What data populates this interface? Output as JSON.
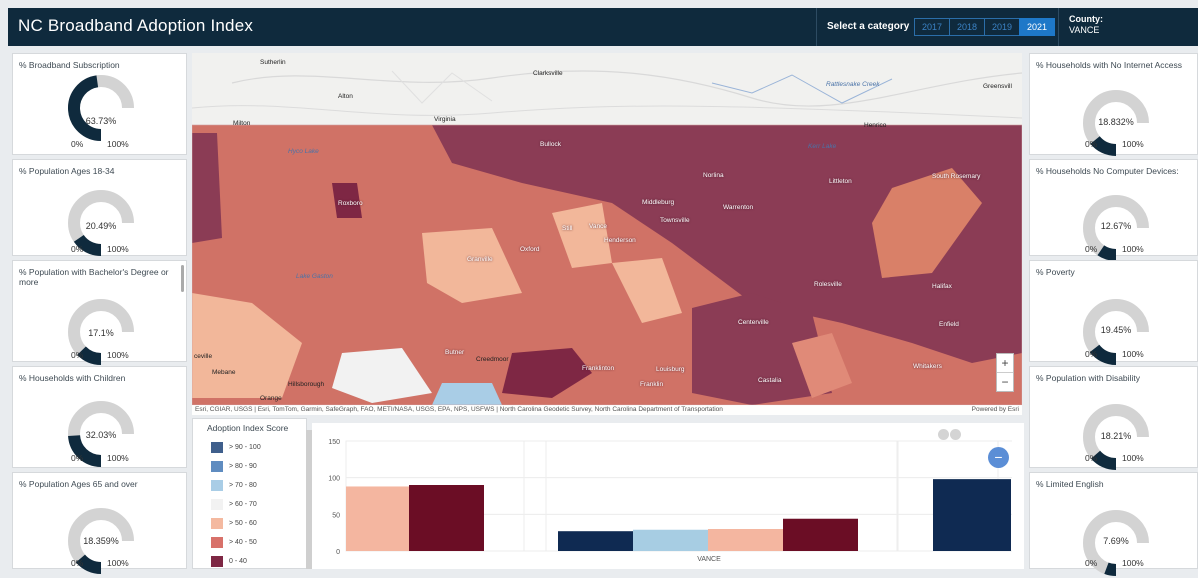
{
  "header": {
    "title": "NC Broadband Adoption Index",
    "category_label": "Select a category",
    "years": [
      "2017",
      "2018",
      "2019",
      "2021"
    ],
    "selected_year": "2021",
    "county_label": "County:",
    "county_value": "VANCE"
  },
  "left_cards": [
    {
      "title": "% Broadband Subscription",
      "pct_text": "63.73%",
      "value": 63.73,
      "min": "0%",
      "max": "100%"
    },
    {
      "title": "% Population Ages 18-34",
      "pct_text": "20.49%",
      "value": 20.49,
      "min": "0%",
      "max": "100%"
    },
    {
      "title": "% Population with Bachelor's Degree or more",
      "pct_text": "17.1%",
      "value": 17.1,
      "min": "0%",
      "max": "100%"
    },
    {
      "title": "% Households with Children",
      "pct_text": "32.03%",
      "value": 32.03,
      "min": "0%",
      "max": "100%"
    },
    {
      "title": "% Population Ages 65 and over",
      "pct_text": "18.359%",
      "value": 18.359,
      "min": "0%",
      "max": "100%"
    }
  ],
  "right_cards": [
    {
      "title": "% Households with No Internet Access",
      "pct_text": "18.832%",
      "value": 18.832,
      "min": "0%",
      "max": "100%"
    },
    {
      "title": "% Households No Computer Devices:",
      "pct_text": "12.67%",
      "value": 12.67,
      "min": "0%",
      "max": "100%"
    },
    {
      "title": "% Poverty",
      "pct_text": "19.45%",
      "value": 19.45,
      "min": "0%",
      "max": "100%"
    },
    {
      "title": "% Population with Disability",
      "pct_text": "18.21%",
      "value": 18.21,
      "min": "0%",
      "max": "100%"
    },
    {
      "title": "% Limited English",
      "pct_text": "7.69%",
      "value": 7.69,
      "min": "0%",
      "max": "100%"
    }
  ],
  "gauge_colors": {
    "fill": "#0f2a3d",
    "track": "#d3d3d3"
  },
  "map": {
    "places": {
      "sutherlin": "Sutherlin",
      "alton": "Alton",
      "clarksville": "Clarksville",
      "greensville": "Greensvill",
      "milton": "Milton",
      "virginia": "Virginia",
      "henrico": "Henrico",
      "bullock": "Bullock",
      "roxboro": "Roxboro",
      "townsville": "Townsville",
      "norlina": "Norlina",
      "warrenton": "Warrenton",
      "middleburg": "Middleburg",
      "vance": "Vance",
      "henderson": "Henderson",
      "oxford": "Oxford",
      "south_rosemary": "South Rosemary",
      "littleton": "Littleton",
      "stovall": "Stovall",
      "rolesville": "Rolesville",
      "halifax": "Halifax",
      "louisburg": "Louisburg",
      "butner": "Butner",
      "creedmoor": "Creedmoor",
      "franklinton": "Franklinton",
      "castalia": "Castalia",
      "enfield": "Enfield",
      "centerville": "Centerville",
      "mebane": "Mebane",
      "hillsborough": "Hillsborough",
      "whitakers": "Whitakers",
      "orange": "Orange",
      "leaf": "Leaf",
      "ceville": "ceville",
      "still": "Still",
      "rattlesnake": "Rattlesnake Creek",
      "kerr": "Kerr Lake",
      "hyco": "Hyco Lake",
      "lake_gaston": "Lake Gaston",
      "franklin": "Franklin",
      "granville": "Granville"
    },
    "attribution": "Esri, CGIAR, USGS | Esri, TomTom, Garmin, SafeGraph, FAO, METI/NASA, USGS, EPA, NPS, USFWS | North Carolina Geodetic Survey, North Carolina Department of Transportation",
    "powered_by": "Powered by Esri",
    "zoom_in": "+",
    "zoom_out": "−"
  },
  "legend": {
    "title": "Adoption Index Score",
    "items": [
      {
        "label": "> 90 - 100",
        "color": "#3f5f8c"
      },
      {
        "label": "> 80 - 90",
        "color": "#5f8cc0"
      },
      {
        "label": "> 70 - 80",
        "color": "#a9cde6"
      },
      {
        "label": "> 60 - 70",
        "color": "#f2f2f2"
      },
      {
        "label": "> 50 - 60",
        "color": "#f4b9a0"
      },
      {
        "label": "> 40 - 50",
        "color": "#d8716a"
      },
      {
        "label": "0 - 40",
        "color": "#7e2744"
      }
    ]
  },
  "chart_data": {
    "type": "bar",
    "yticks": [
      0,
      50,
      100,
      150
    ],
    "ylim": [
      0,
      150
    ],
    "category_label": "VANCE",
    "bars": [
      {
        "value": 88,
        "color": "#f4b6a0"
      },
      {
        "value": 90,
        "color": "#6b0d25"
      },
      {
        "value": 27,
        "color": "#0f2a52"
      },
      {
        "value": 29,
        "color": "#a7cde3"
      },
      {
        "value": 30,
        "color": "#f4b6a0"
      },
      {
        "value": 44,
        "color": "#6b0d25"
      },
      {
        "value": 98,
        "color": "#0f2a52"
      }
    ]
  },
  "chart_controls": {
    "collapse": "−"
  }
}
